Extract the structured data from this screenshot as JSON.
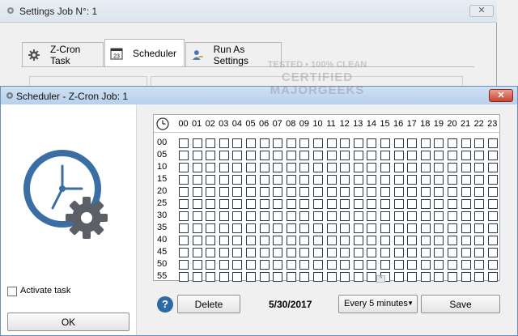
{
  "background_window": {
    "title": "Settings Job N°: 1",
    "close_glyph": "✕",
    "tabs": [
      {
        "label": "Z-Cron Task",
        "icon": "gear-icon"
      },
      {
        "label": "Scheduler",
        "icon": "calendar-icon",
        "calendar_day": "23"
      },
      {
        "label": "Run As Settings",
        "icon": "user-key-icon"
      }
    ]
  },
  "watermark": {
    "line1": "TESTED • 100% CLEAN",
    "line2": "CERTIFIED",
    "line3": "MAJORGEEKS"
  },
  "dialog": {
    "title": "Scheduler - Z-Cron Job: 1",
    "close_glyph": "✕",
    "left_pane": {
      "icon": "clock-gear-icon",
      "activate_label": "Activate task",
      "activate_checked": false,
      "ok_label": "OK"
    },
    "grid": {
      "header_icon": "clock-icon",
      "hours": [
        "00",
        "01",
        "02",
        "03",
        "04",
        "05",
        "06",
        "07",
        "08",
        "09",
        "10",
        "11",
        "12",
        "13",
        "14",
        "15",
        "16",
        "17",
        "18",
        "19",
        "20",
        "21",
        "22",
        "23"
      ],
      "minutes": [
        "00",
        "05",
        "10",
        "15",
        "20",
        "25",
        "30",
        "35",
        "40",
        "45",
        "50",
        "55"
      ],
      "checked_cells": [],
      "scroll_glyph": "^"
    },
    "bottom": {
      "help_glyph": "?",
      "delete_label": "Delete",
      "date": "5/30/2017",
      "interval_value": "Every 5 minutes",
      "interval_arrow": "▼",
      "save_label": "Save"
    },
    "colors": {
      "accent_blue": "#2d6aa6",
      "clock_face": "#3a6ea5",
      "gear": "#5b5f66",
      "close_red": "#c7432f"
    }
  }
}
